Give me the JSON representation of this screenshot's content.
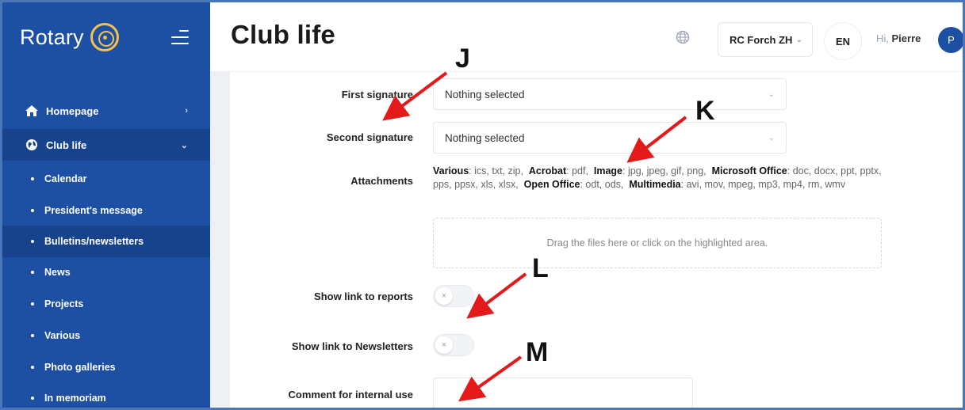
{
  "sidebar": {
    "logo_text": "Rotary",
    "nav": [
      {
        "label": "Homepage",
        "chevron": "›"
      },
      {
        "label": "Club life",
        "chevron": "⌄"
      }
    ],
    "sub_items": [
      {
        "label": "Calendar"
      },
      {
        "label": "President's message"
      },
      {
        "label": "Bulletins/newsletters"
      },
      {
        "label": "News"
      },
      {
        "label": "Projects"
      },
      {
        "label": "Various"
      },
      {
        "label": "Photo galleries"
      },
      {
        "label": "In memoriam"
      }
    ]
  },
  "header": {
    "title": "Club life",
    "club_select": "RC Forch ZH",
    "language": "EN",
    "greeting_prefix": "Hi,",
    "user_name": "Pierre",
    "avatar_initial": "P"
  },
  "form": {
    "first_signature": {
      "label": "First signature",
      "value": "Nothing selected"
    },
    "second_signature": {
      "label": "Second signature",
      "value": "Nothing selected"
    },
    "attachments": {
      "label": "Attachments",
      "groups": [
        {
          "name": "Various",
          "types": ": ics, txt, zip,"
        },
        {
          "name": "Acrobat",
          "types": ": pdf,"
        },
        {
          "name": "Image",
          "types": ": jpg, jpeg, gif, png,"
        },
        {
          "name": "Microsoft Office",
          "types": ": doc, docx, ppt, pptx, pps, ppsx, xls, xlsx,"
        },
        {
          "name": "Open Office",
          "types": ": odt, ods,"
        },
        {
          "name": "Multimedia",
          "types": ": avi, mov, mpeg, mp3, mp4, rm, wmv"
        }
      ],
      "dropzone_text": "Drag the files here or click on the highlighted area."
    },
    "show_link_reports": {
      "label": "Show link to reports",
      "toggle_symbol": "×"
    },
    "show_link_newsletters": {
      "label": "Show link to Newsletters",
      "toggle_symbol": "×"
    },
    "comment": {
      "label": "Comment for internal use",
      "value": ""
    }
  },
  "annotations": [
    {
      "letter": "J"
    },
    {
      "letter": "K"
    },
    {
      "letter": "L"
    },
    {
      "letter": "M"
    }
  ],
  "colors": {
    "sidebar": "#1d4fa3",
    "sidebar_active": "#17438d",
    "accent_gold": "#f3c24a",
    "arrow": "#e41a1a"
  },
  "icons": {
    "homepage": "home-icon",
    "club_life": "globe-icon",
    "header_globe": "globe-icon",
    "menu": "hamburger-icon"
  }
}
